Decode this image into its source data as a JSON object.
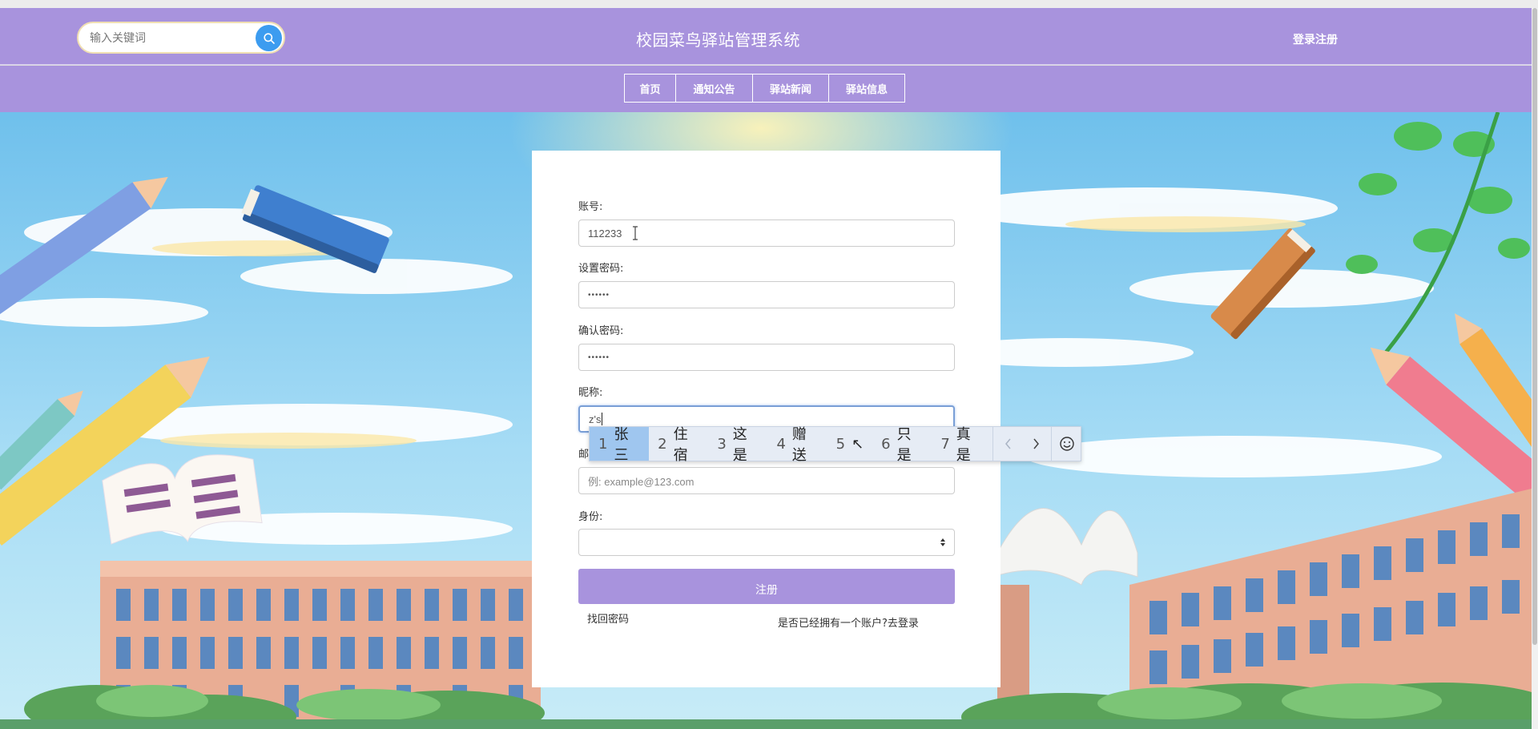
{
  "header": {
    "search_placeholder": "输入关键词",
    "title": "校园菜鸟驿站管理系统",
    "login_link": "登录注册"
  },
  "nav": {
    "items": [
      {
        "label": "首页"
      },
      {
        "label": "通知公告"
      },
      {
        "label": "驿站新闻"
      },
      {
        "label": "驿站信息"
      }
    ]
  },
  "form": {
    "account": {
      "label": "账号:",
      "value": "112233"
    },
    "password": {
      "label": "设置密码:",
      "value": "••••••"
    },
    "confirm_password": {
      "label": "确认密码:",
      "value": "••••••"
    },
    "nickname": {
      "label": "昵称:",
      "value": "z's"
    },
    "email": {
      "label": "邮",
      "placeholder": "例: example@123.com"
    },
    "role": {
      "label": "身份:",
      "value": ""
    },
    "submit_label": "注册",
    "forgot_link": "找回密码",
    "login_link": "是否已经拥有一个账户?去登录"
  },
  "ime": {
    "candidates": [
      {
        "num": "1",
        "text": "张三",
        "selected": true
      },
      {
        "num": "2",
        "text": "住宿"
      },
      {
        "num": "3",
        "text": "这是"
      },
      {
        "num": "4",
        "text": "赠送"
      },
      {
        "num": "5",
        "text": "↖"
      },
      {
        "num": "6",
        "text": "只是"
      },
      {
        "num": "7",
        "text": "真是"
      }
    ],
    "prev_icon": "chevron-left-icon",
    "next_icon": "chevron-right-icon",
    "emoji_icon": "smiley-icon"
  },
  "colors": {
    "header_bg": "#a893dd",
    "search_button": "#3c9cf0",
    "submit_button": "#a893dd",
    "ime_selected": "#9fc6ef"
  }
}
